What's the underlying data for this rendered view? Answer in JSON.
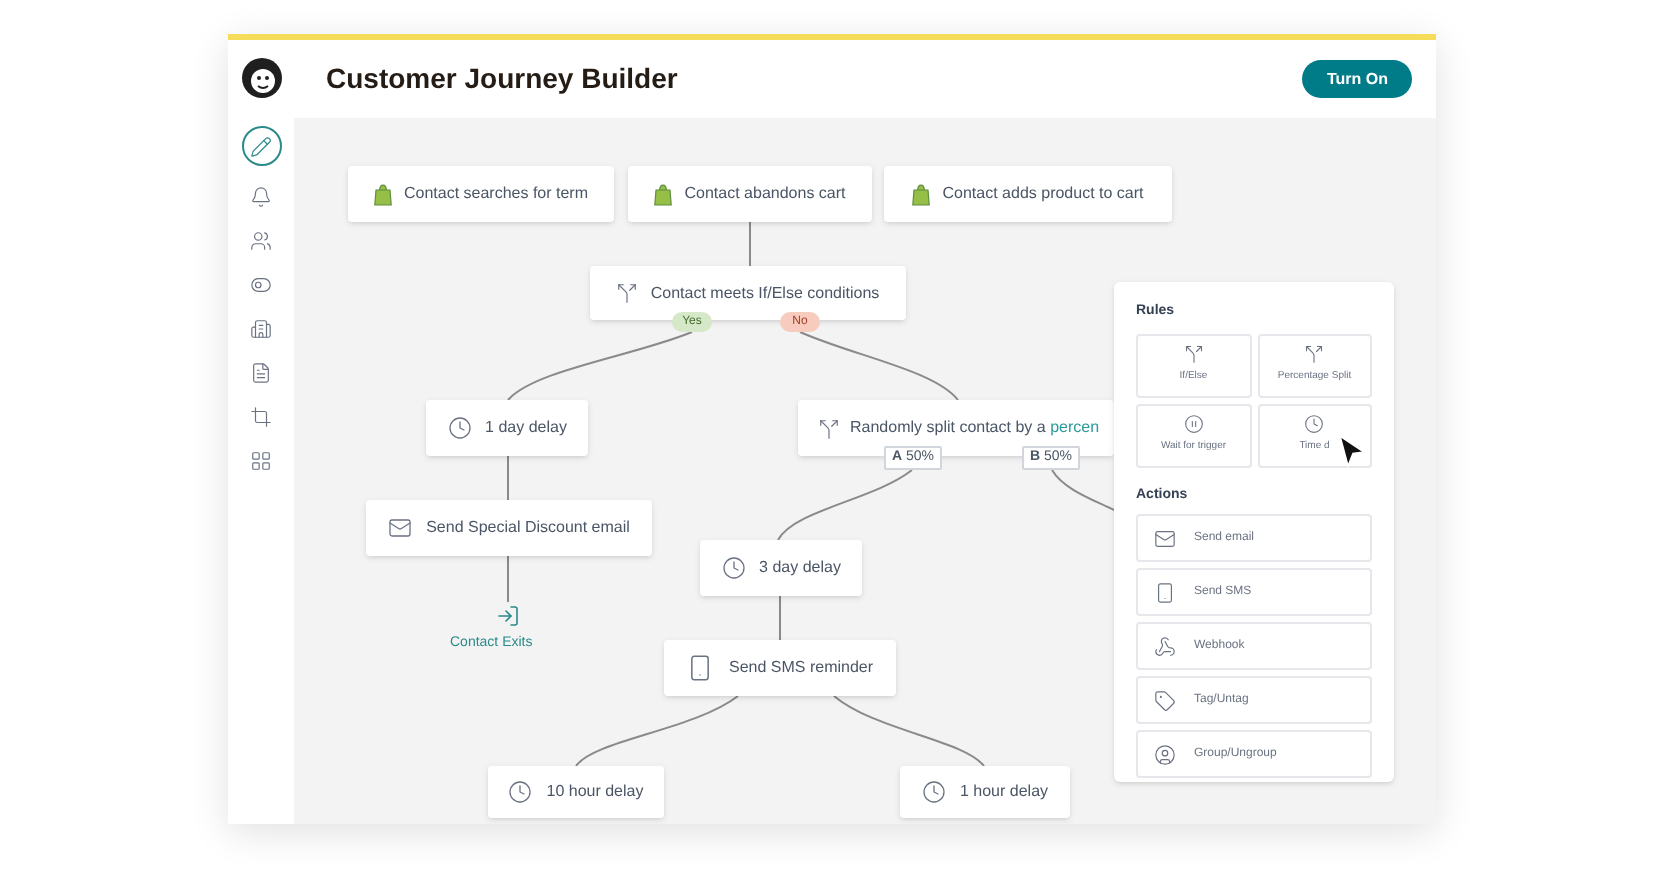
{
  "app": {
    "title": "Customer Journey Builder",
    "button": "Turn On"
  },
  "sidebar": {
    "items": [
      {
        "kind": "pencil",
        "selected": true
      },
      {
        "kind": "bell",
        "selected": false
      },
      {
        "kind": "people",
        "selected": false
      },
      {
        "kind": "toggle",
        "selected": false
      },
      {
        "kind": "building",
        "selected": false
      },
      {
        "kind": "page",
        "selected": false
      },
      {
        "kind": "crop",
        "selected": false
      },
      {
        "kind": "grid",
        "selected": false
      }
    ]
  },
  "triggers": [
    {
      "label": "Contact searches for term"
    },
    {
      "label": "Contact abandons cart"
    },
    {
      "label": "Contact adds product to cart"
    }
  ],
  "condition": {
    "label": "Contact meets If/Else conditions",
    "yes": "Yes",
    "no": "No"
  },
  "split": {
    "label": "Randomly split contact by a",
    "link": "percen",
    "branches": [
      "**A** 50%",
      "**B** 50%"
    ]
  },
  "steps": [
    {
      "kind": "delay",
      "label": "1 day delay"
    },
    {
      "kind": "email",
      "label": "Send Special Discount email"
    },
    {
      "kind": "delay",
      "label": "3 day delay"
    },
    {
      "kind": "sms",
      "label": "Send SMS reminder"
    },
    {
      "kind": "delay",
      "label": "10 hour delay"
    },
    {
      "kind": "delay",
      "label": "1 hour delay"
    }
  ],
  "exit": {
    "label": "Contact Exits"
  },
  "panel": {
    "rules_title": "Rules",
    "rules": [
      {
        "kind": "split",
        "label": "If/Else"
      },
      {
        "kind": "split",
        "label": "Percentage Split"
      },
      {
        "kind": "pause",
        "label": "Wait for trigger"
      },
      {
        "kind": "clock",
        "label": "Time d"
      }
    ],
    "actions_title": "Actions",
    "actions": [
      {
        "kind": "email",
        "label": "Send email"
      },
      {
        "kind": "sms",
        "label": "Send SMS"
      },
      {
        "kind": "webhook",
        "label": "Webhook"
      },
      {
        "kind": "tag",
        "label": "Tag/Untag"
      },
      {
        "kind": "group",
        "label": "Group/Ungroup"
      }
    ]
  }
}
